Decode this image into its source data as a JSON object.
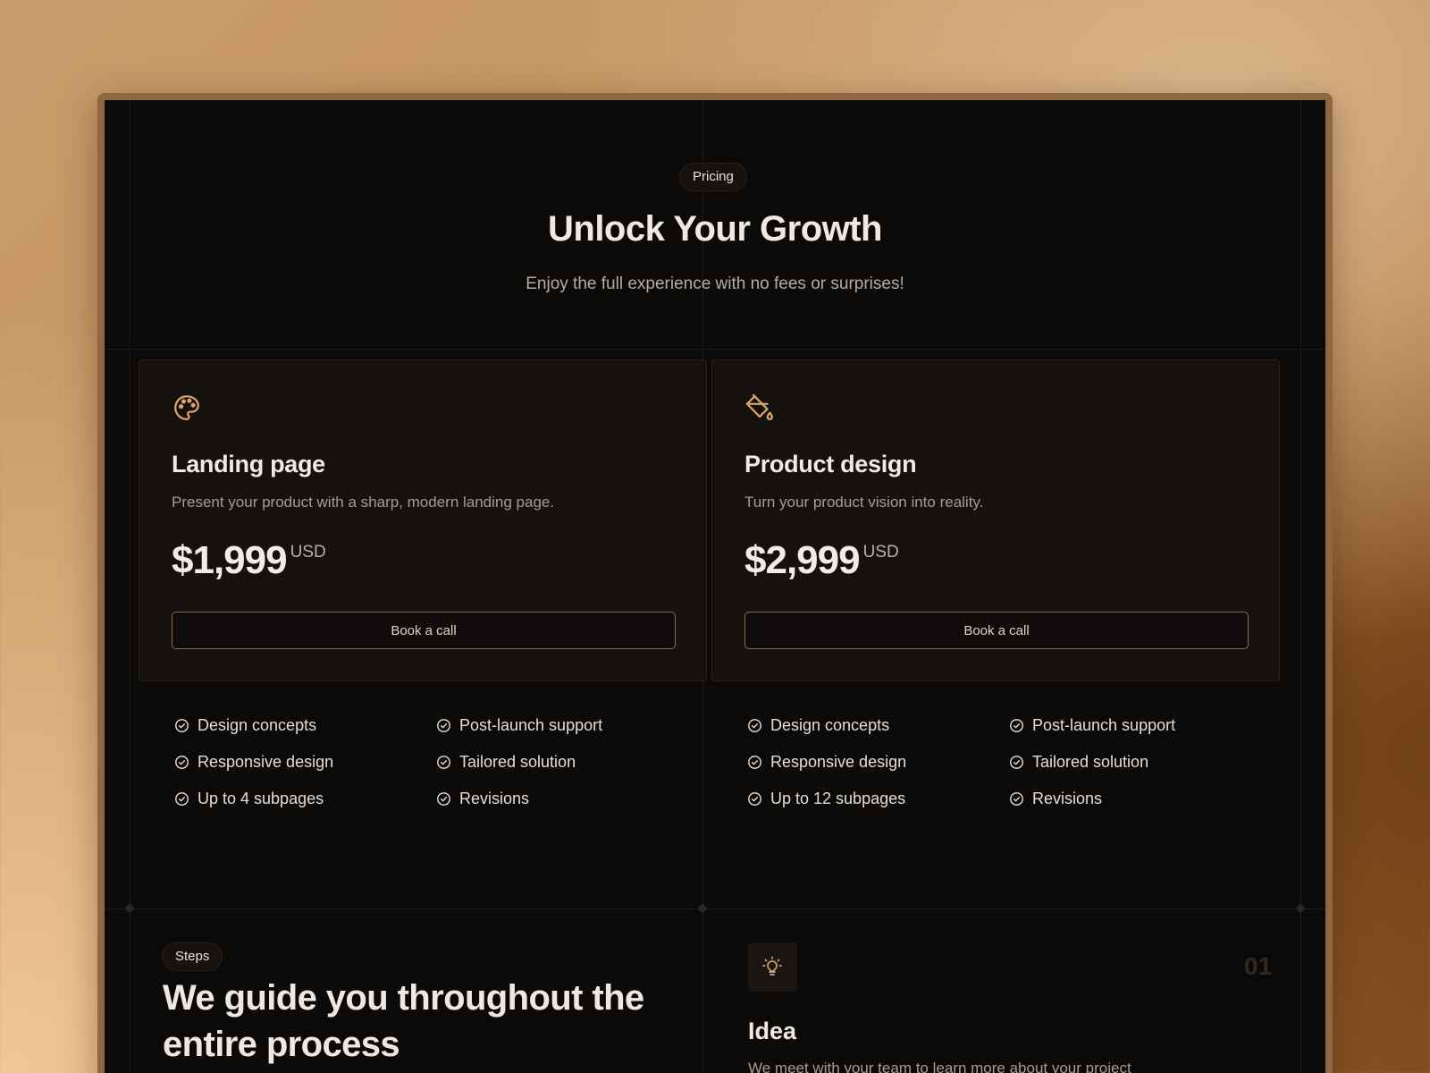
{
  "pricing_section": {
    "badge": "Pricing",
    "title": "Unlock Your Growth",
    "subtitle": "Enjoy the full experience with no fees or surprises!"
  },
  "plans": [
    {
      "icon": "palette-icon",
      "title": "Landing page",
      "description": "Present your product with a sharp, modern landing page.",
      "price": "$1,999",
      "currency": "USD",
      "button_label": "Book a call",
      "features": [
        "Design concepts",
        "Post-launch support",
        "Responsive design",
        "Tailored solution",
        "Up to 4 subpages",
        "Revisions"
      ]
    },
    {
      "icon": "paint-bucket-icon",
      "title": "Product design",
      "description": "Turn your product vision into reality.",
      "price": "$2,999",
      "currency": "USD",
      "button_label": "Book a call",
      "features": [
        "Design concepts",
        "Post-launch support",
        "Responsive design",
        "Tailored solution",
        "Up to 12 subpages",
        "Revisions"
      ]
    }
  ],
  "steps_section": {
    "badge": "Steps",
    "title": "We guide you throughout the entire process",
    "step": {
      "icon": "lightbulb-icon",
      "number": "01",
      "title": "Idea",
      "description": "We meet with your team to learn more about your project"
    }
  },
  "colors": {
    "background": "#0c0a09",
    "card": "#15110f",
    "accent": "#d9a36a",
    "button_border": "#8f6d48"
  }
}
